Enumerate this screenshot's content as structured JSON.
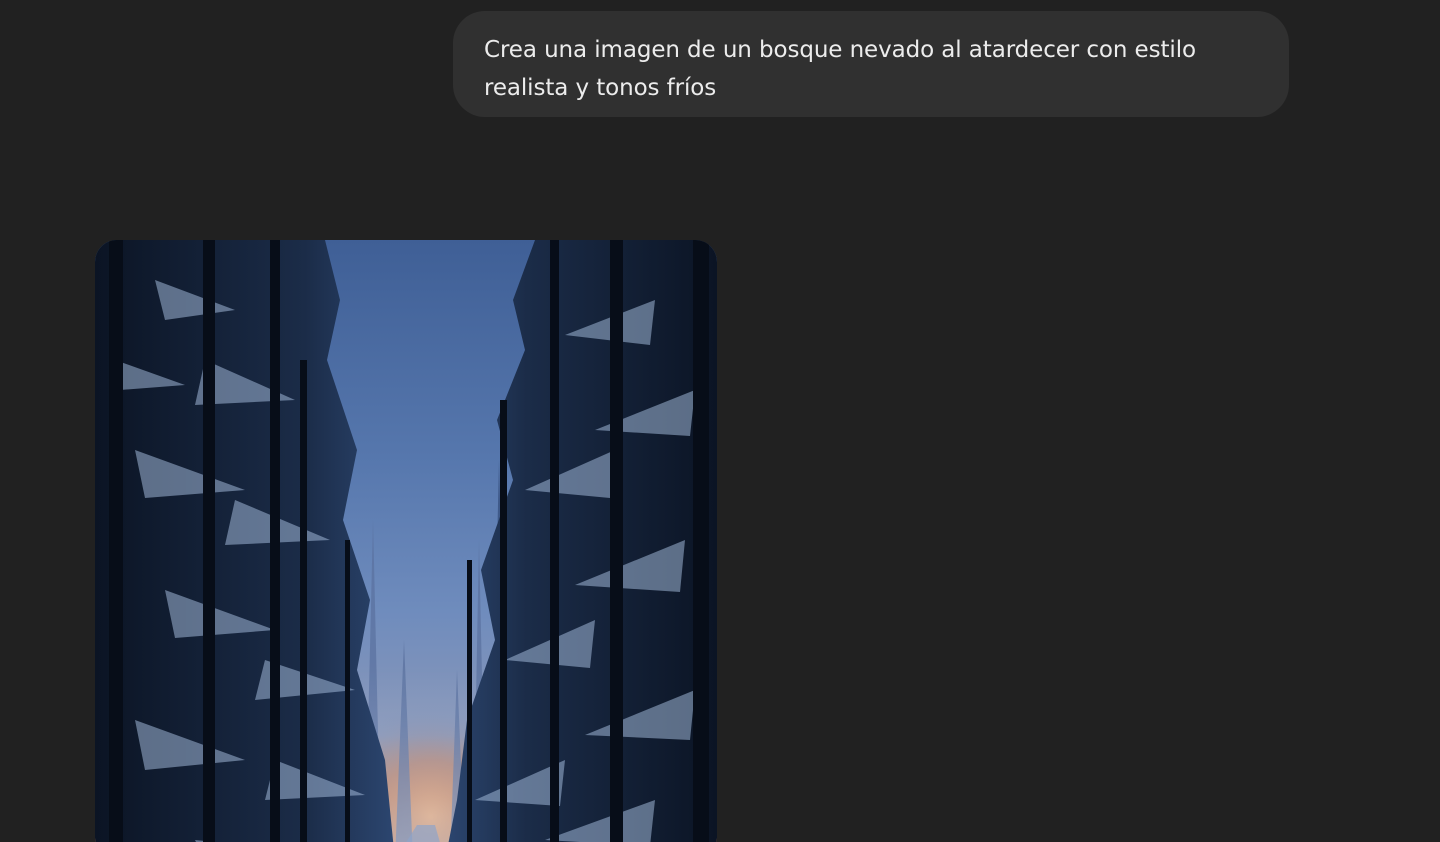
{
  "conversation": {
    "user_message": {
      "text": "Crea una imagen de un bosque nevado al atardecer con estilo realista y tonos fríos"
    },
    "assistant_message": {
      "image": {
        "kind": "generated-image",
        "subject": "snowy-forest-sunset"
      }
    }
  },
  "colors": {
    "background": "#212121",
    "user_bubble": "#303030",
    "user_text": "#ececec",
    "sky_top": "#4d6fa8",
    "sky_glow": "#e08a55",
    "tree_dark": "#0f1a2c",
    "snow": "#a9bfdc"
  }
}
